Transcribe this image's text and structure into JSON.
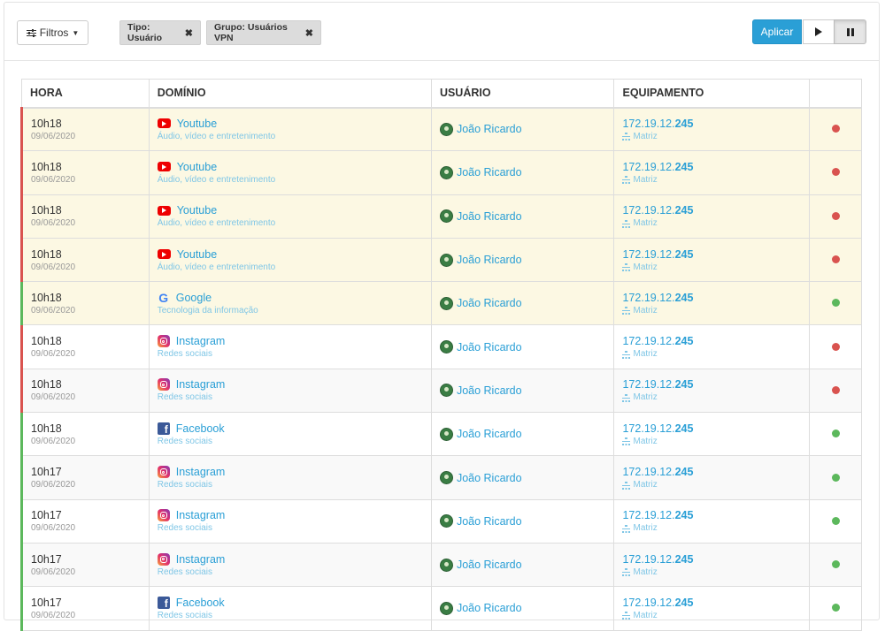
{
  "toolbar": {
    "filters_label": "Filtros",
    "chips": [
      {
        "label": "Tipo: Usuário"
      },
      {
        "label": "Grupo: Usuários VPN"
      }
    ],
    "apply_label": "Aplicar"
  },
  "table": {
    "headers": [
      "HORA",
      "DOMÍNIO",
      "USUÁRIO",
      "EQUIPAMENTO",
      ""
    ],
    "rows": [
      {
        "time": "10h18",
        "date": "09/06/2020",
        "domain": "Youtube",
        "icon": "youtube-icon",
        "category": "Áudio, vídeo e entretenimento",
        "user": "João Ricardo",
        "ip_prefix": "172.19.12.",
        "ip_suffix": "245",
        "location": "Matriz",
        "status": "blocked"
      },
      {
        "time": "10h18",
        "date": "09/06/2020",
        "domain": "Youtube",
        "icon": "youtube-icon",
        "category": "Áudio, vídeo e entretenimento",
        "user": "João Ricardo",
        "ip_prefix": "172.19.12.",
        "ip_suffix": "245",
        "location": "Matriz",
        "status": "blocked"
      },
      {
        "time": "10h18",
        "date": "09/06/2020",
        "domain": "Youtube",
        "icon": "youtube-icon",
        "category": "Áudio, vídeo e entretenimento",
        "user": "João Ricardo",
        "ip_prefix": "172.19.12.",
        "ip_suffix": "245",
        "location": "Matriz",
        "status": "blocked"
      },
      {
        "time": "10h18",
        "date": "09/06/2020",
        "domain": "Youtube",
        "icon": "youtube-icon",
        "category": "Áudio, vídeo e entretenimento",
        "user": "João Ricardo",
        "ip_prefix": "172.19.12.",
        "ip_suffix": "245",
        "location": "Matriz",
        "status": "blocked"
      },
      {
        "time": "10h18",
        "date": "09/06/2020",
        "domain": "Google",
        "icon": "google-icon",
        "category": "Tecnologia da informação",
        "user": "João Ricardo",
        "ip_prefix": "172.19.12.",
        "ip_suffix": "245",
        "location": "Matriz",
        "status": "allowed"
      },
      {
        "time": "10h18",
        "date": "09/06/2020",
        "domain": "Instagram",
        "icon": "instagram-icon",
        "category": "Redes sociais",
        "user": "João Ricardo",
        "ip_prefix": "172.19.12.",
        "ip_suffix": "245",
        "location": "Matriz",
        "status": "blocked"
      },
      {
        "time": "10h18",
        "date": "09/06/2020",
        "domain": "Instagram",
        "icon": "instagram-icon",
        "category": "Redes sociais",
        "user": "João Ricardo",
        "ip_prefix": "172.19.12.",
        "ip_suffix": "245",
        "location": "Matriz",
        "status": "blocked"
      },
      {
        "time": "10h18",
        "date": "09/06/2020",
        "domain": "Facebook",
        "icon": "facebook-icon",
        "category": "Redes sociais",
        "user": "João Ricardo",
        "ip_prefix": "172.19.12.",
        "ip_suffix": "245",
        "location": "Matriz",
        "status": "allowed"
      },
      {
        "time": "10h17",
        "date": "09/06/2020",
        "domain": "Instagram",
        "icon": "instagram-icon",
        "category": "Redes sociais",
        "user": "João Ricardo",
        "ip_prefix": "172.19.12.",
        "ip_suffix": "245",
        "location": "Matriz",
        "status": "allowed"
      },
      {
        "time": "10h17",
        "date": "09/06/2020",
        "domain": "Instagram",
        "icon": "instagram-icon",
        "category": "Redes sociais",
        "user": "João Ricardo",
        "ip_prefix": "172.19.12.",
        "ip_suffix": "245",
        "location": "Matriz",
        "status": "allowed"
      },
      {
        "time": "10h17",
        "date": "09/06/2020",
        "domain": "Instagram",
        "icon": "instagram-icon",
        "category": "Redes sociais",
        "user": "João Ricardo",
        "ip_prefix": "172.19.12.",
        "ip_suffix": "245",
        "location": "Matriz",
        "status": "allowed"
      },
      {
        "time": "10h17",
        "date": "09/06/2020",
        "domain": "Facebook",
        "icon": "facebook-icon",
        "category": "Redes sociais",
        "user": "João Ricardo",
        "ip_prefix": "172.19.12.",
        "ip_suffix": "245",
        "location": "Matriz",
        "status": "allowed"
      }
    ]
  },
  "colors": {
    "accent": "#2a9fd6",
    "blocked": "#d9534f",
    "allowed": "#5cb85c",
    "highlight_row": "#fcf8e3"
  }
}
